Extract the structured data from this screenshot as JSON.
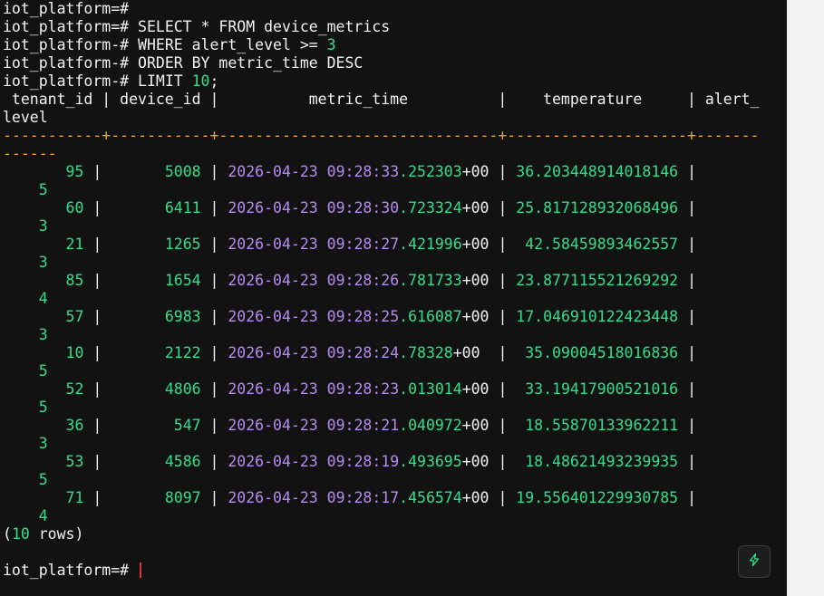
{
  "terminal": {
    "prompt": "iot_platform=#",
    "cont_prompt": "iot_platform-#",
    "query": {
      "line1": "SELECT * FROM device_metrics",
      "line2_pre": "WHERE alert_level >= ",
      "line2_num": "3",
      "line3": "ORDER BY metric_time DESC",
      "line4_pre": "LIMIT ",
      "line4_num": "10",
      "line4_post": ";"
    },
    "header": {
      "line1": " tenant_id | device_id |          metric_time          |    temperature     | alert_",
      "line2": "level"
    },
    "divider": {
      "line1": "-----------+-----------+-------------------------------+--------------------+-------",
      "line2": "------"
    },
    "rows": [
      {
        "tenant_id": "       95 ",
        "device_id": "      5008 ",
        "date": "2026-04-23",
        "time": "09:28:33",
        "frac": ".252303",
        "tz": "+00",
        "tzpad": " ",
        "temp": " 36.203448914018146 ",
        "alert": "5"
      },
      {
        "tenant_id": "       60 ",
        "device_id": "      6411 ",
        "date": "2026-04-23",
        "time": "09:28:30",
        "frac": ".723324",
        "tz": "+00",
        "tzpad": " ",
        "temp": " 25.817128932068496 ",
        "alert": "3"
      },
      {
        "tenant_id": "       21 ",
        "device_id": "      1265 ",
        "date": "2026-04-23",
        "time": "09:28:27",
        "frac": ".421996",
        "tz": "+00",
        "tzpad": " ",
        "temp": "  42.58459893462557 ",
        "alert": "3"
      },
      {
        "tenant_id": "       85 ",
        "device_id": "      1654 ",
        "date": "2026-04-23",
        "time": "09:28:26",
        "frac": ".781733",
        "tz": "+00",
        "tzpad": " ",
        "temp": " 23.877115521269292 ",
        "alert": "4"
      },
      {
        "tenant_id": "       57 ",
        "device_id": "      6983 ",
        "date": "2026-04-23",
        "time": "09:28:25",
        "frac": ".616087",
        "tz": "+00",
        "tzpad": " ",
        "temp": " 17.046910122423448 ",
        "alert": "3"
      },
      {
        "tenant_id": "       10 ",
        "device_id": "      2122 ",
        "date": "2026-04-23",
        "time": "09:28:24",
        "frac": ".78328",
        "tz": "+00",
        "tzpad": "  ",
        "temp": "  35.09004518016836 ",
        "alert": "5"
      },
      {
        "tenant_id": "       52 ",
        "device_id": "      4806 ",
        "date": "2026-04-23",
        "time": "09:28:23",
        "frac": ".013014",
        "tz": "+00",
        "tzpad": " ",
        "temp": "  33.19417900521016 ",
        "alert": "5"
      },
      {
        "tenant_id": "       36 ",
        "device_id": "       547 ",
        "date": "2026-04-23",
        "time": "09:28:21",
        "frac": ".040972",
        "tz": "+00",
        "tzpad": " ",
        "temp": "  18.55870133962211 ",
        "alert": "3"
      },
      {
        "tenant_id": "       53 ",
        "device_id": "      4586 ",
        "date": "2026-04-23",
        "time": "09:28:19",
        "frac": ".493695",
        "tz": "+00",
        "tzpad": " ",
        "temp": "  18.48621493239935 ",
        "alert": "5"
      },
      {
        "tenant_id": "       71 ",
        "device_id": "      8097 ",
        "date": "2026-04-23",
        "time": "09:28:17",
        "frac": ".456574",
        "tz": "+00",
        "tzpad": " ",
        "temp": " 19.556401229930785 ",
        "alert": "4"
      }
    ],
    "footer": {
      "open": "(",
      "count": "10",
      "rest": " rows)"
    },
    "quick_action_icon": "lightning-bolt-icon",
    "colors": {
      "background": "#121212",
      "text": "#f2f2f2",
      "number": "#2ee08b",
      "timestamp": "#b689f2",
      "divider": "#f0a52f",
      "cursor": "#e0343a"
    }
  }
}
